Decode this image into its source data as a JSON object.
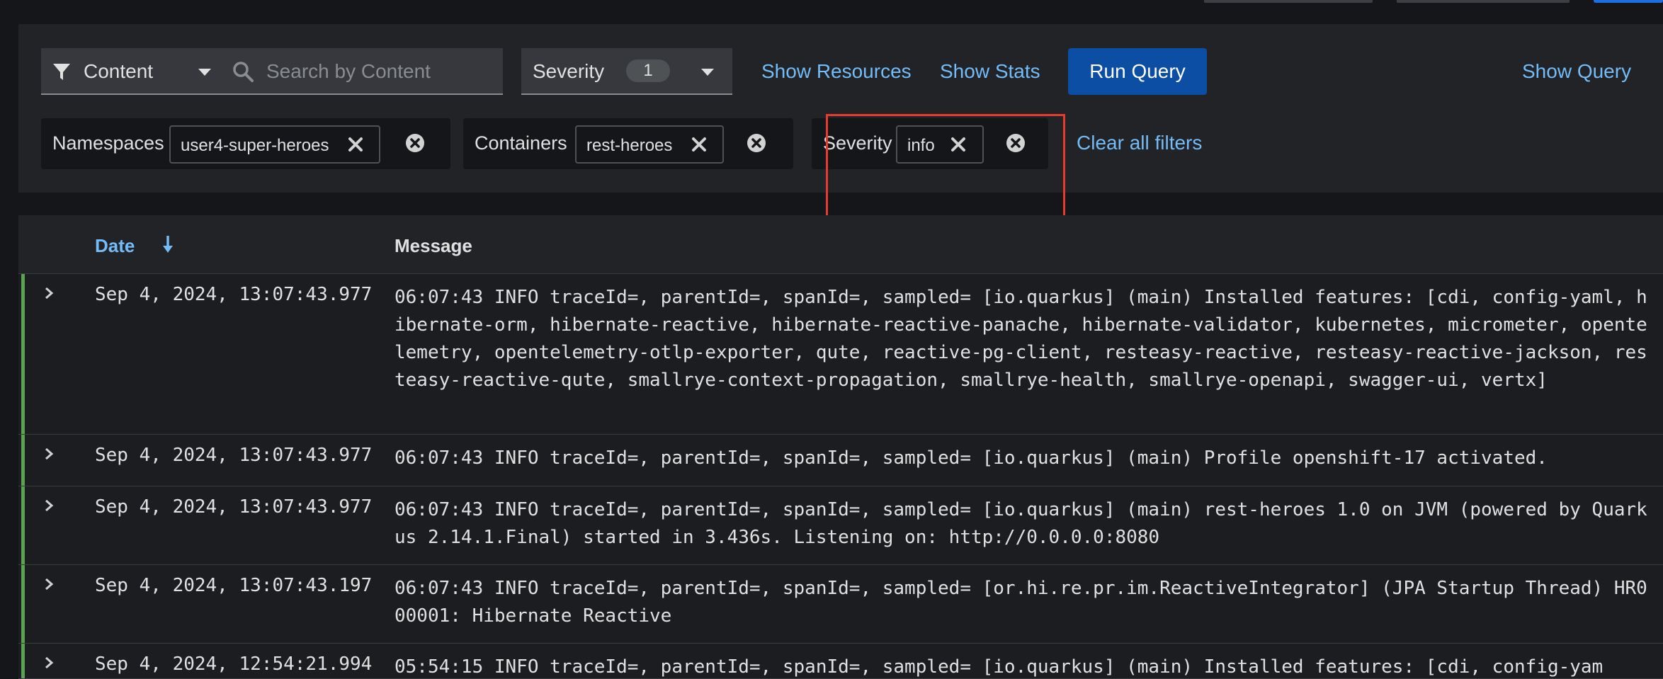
{
  "toolbar": {
    "filter_type_label": "Content",
    "search_placeholder": "Search by Content",
    "severity_select_label": "Severity",
    "severity_count": "1",
    "show_resources": "Show Resources",
    "show_stats": "Show Stats",
    "run_query": "Run Query",
    "show_query": "Show Query"
  },
  "filters": {
    "namespaces": {
      "label": "Namespaces",
      "chip": "user4-super-heroes"
    },
    "containers": {
      "label": "Containers",
      "chip": "rest-heroes"
    },
    "severity": {
      "label": "Severity",
      "chip": "info"
    },
    "clear_all": "Clear all filters"
  },
  "table": {
    "headers": {
      "date": "Date",
      "message": "Message"
    },
    "rows": [
      {
        "date": "Sep 4, 2024, 13:07:43.977",
        "message": "06:07:43 INFO traceId=, parentId=, spanId=, sampled= [io.quarkus] (main) Installed features: [cdi, config-yaml, hibernate-orm, hibernate-reactive, hibernate-reactive-panache, hibernate-validator, kubernetes, micrometer, opentelemetry, opentelemetry-otlp-exporter, qute, reactive-pg-client, resteasy-reactive, resteasy-reactive-jackson, resteasy-reactive-qute, smallrye-context-propagation, smallrye-health, smallrye-openapi, swagger-ui, vertx]"
      },
      {
        "date": "Sep 4, 2024, 13:07:43.977",
        "message": "06:07:43 INFO traceId=, parentId=, spanId=, sampled= [io.quarkus] (main) Profile openshift-17 activated."
      },
      {
        "date": "Sep 4, 2024, 13:07:43.977",
        "message": "06:07:43 INFO traceId=, parentId=, spanId=, sampled= [io.quarkus] (main) rest-heroes 1.0 on JVM (powered by Quarkus 2.14.1.Final) started in 3.436s. Listening on: http://0.0.0.0:8080"
      },
      {
        "date": "Sep 4, 2024, 13:07:43.197",
        "message": "06:07:43 INFO traceId=, parentId=, spanId=, sampled= [or.hi.re.pr.im.ReactiveIntegrator] (JPA Startup Thread) HR000001: Hibernate Reactive"
      },
      {
        "date": "Sep 4, 2024, 12:54:21.994",
        "message": "05:54:15 INFO traceId=, parentId=, spanId=, sampled= [io.quarkus] (main) Installed features: [cdi, config-yam"
      }
    ]
  },
  "colors": {
    "accent_link": "#73bcf7",
    "primary_button": "#0b4ea3",
    "row_accent": "#5ba352",
    "highlight_box": "#e63b2e"
  },
  "icons": {
    "filter": "funnel-icon",
    "search": "search-icon",
    "caret": "caret-down-icon",
    "chip_remove": "close-icon",
    "group_remove": "times-circle-icon",
    "sort": "sort-down-arrow-icon",
    "expand": "chevron-right-icon"
  }
}
